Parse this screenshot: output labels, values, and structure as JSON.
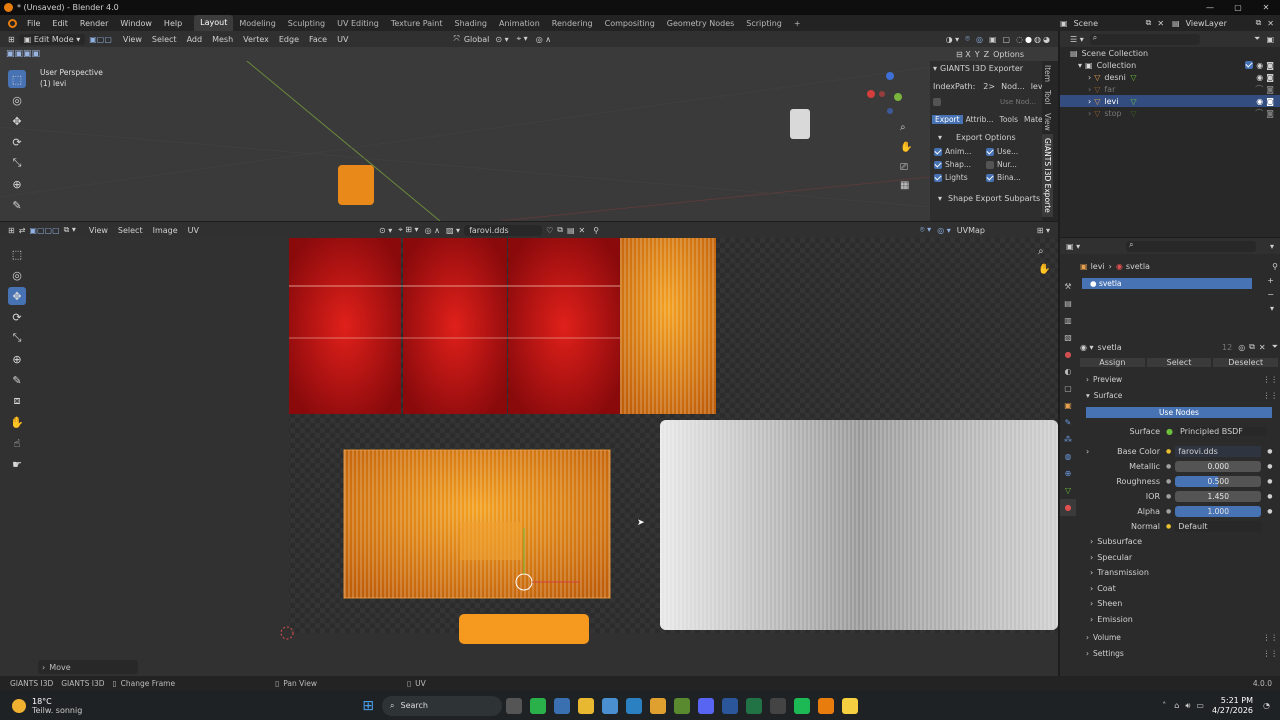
{
  "window": {
    "title": "* (Unsaved) - Blender 4.0"
  },
  "menu": {
    "items": [
      "File",
      "Edit",
      "Render",
      "Window",
      "Help"
    ]
  },
  "workspaces": [
    "Layout",
    "Modeling",
    "Sculpting",
    "UV Editing",
    "Texture Paint",
    "Shading",
    "Animation",
    "Rendering",
    "Compositing",
    "Geometry Nodes",
    "Scripting"
  ],
  "active_workspace": "Layout",
  "top_right": {
    "scene": "Scene",
    "view_layer": "ViewLayer"
  },
  "viewport": {
    "mode": "Edit Mode",
    "menu": [
      "View",
      "Select",
      "Add",
      "Mesh",
      "Vertex",
      "Edge",
      "Face",
      "UV"
    ],
    "transform": "Global",
    "options": "Options",
    "overlay_text_1": "User Perspective",
    "overlay_text_2": "(1) levi"
  },
  "giants": {
    "title": "GIANTS I3D Exporter",
    "index_path_label": "IndexPath:",
    "index_path_val": "2>",
    "node_label": "Nod...",
    "node_val": "levi",
    "use_node": "Use Nod...",
    "tabs": [
      "Export",
      "Attrib...",
      "Tools",
      "Mate..."
    ],
    "export_options": "Export Options",
    "checks": [
      {
        "label": "Anim...",
        "on": true
      },
      {
        "label": "Use...",
        "on": true
      },
      {
        "label": "Shap...",
        "on": true
      },
      {
        "label": "Nur...",
        "on": false
      },
      {
        "label": "Lights",
        "on": true
      },
      {
        "label": "Bina...",
        "on": true
      }
    ],
    "subparts": "Shape Export Subparts",
    "side_tabs": [
      "Item",
      "Tool",
      "View",
      "GIANTS I3D Exporte"
    ]
  },
  "uv_editor": {
    "menu": [
      "View",
      "Select",
      "Image",
      "UV"
    ],
    "image": "farovi.dds",
    "uvmap": "UVMap",
    "move_panel": "Move"
  },
  "outliner": {
    "root": "Scene Collection",
    "collection": "Collection",
    "items": [
      {
        "name": "desni",
        "active": false,
        "dim": false
      },
      {
        "name": "far",
        "active": false,
        "dim": true
      },
      {
        "name": "levi",
        "active": true,
        "dim": false
      },
      {
        "name": "stop",
        "active": false,
        "dim": true
      }
    ]
  },
  "properties": {
    "breadcrumb_obj": "levi",
    "breadcrumb_mat": "svetla",
    "slot": "svetla",
    "material_name": "svetla",
    "user_count": "12",
    "assign": "Assign",
    "select": "Select",
    "deselect": "Deselect",
    "preview": "Preview",
    "surface_panel": "Surface",
    "use_nodes": "Use Nodes",
    "surface_label": "Surface",
    "surface_value": "Principled BSDF",
    "fields": [
      {
        "label": "Base Color",
        "value": "farovi.dds",
        "kind": "link",
        "fill": 0
      },
      {
        "label": "Metallic",
        "value": "0.000",
        "kind": "slider",
        "fill": 0
      },
      {
        "label": "Roughness",
        "value": "0.500",
        "kind": "slider",
        "fill": 0.5
      },
      {
        "label": "IOR",
        "value": "1.450",
        "kind": "slider",
        "fill": 0
      },
      {
        "label": "Alpha",
        "value": "1.000",
        "kind": "slider",
        "fill": 1
      },
      {
        "label": "Normal",
        "value": "Default",
        "kind": "link",
        "fill": 0
      }
    ],
    "subpanels": [
      "Subsurface",
      "Specular",
      "Transmission",
      "Coat",
      "Sheen",
      "Emission"
    ],
    "volume": "Volume",
    "settings": "Settings"
  },
  "statusbar": {
    "left1": "GIANTS I3D",
    "left2": "GIANTS I3D",
    "change_frame": "Change Frame",
    "pan_view": "Pan View",
    "uv": "UV",
    "version": "4.0.0"
  },
  "taskbar": {
    "temp": "18°C",
    "weather": "Teilw. sonnig",
    "search": "Search",
    "time": "5:21 PM",
    "date": "4/27/2026"
  }
}
